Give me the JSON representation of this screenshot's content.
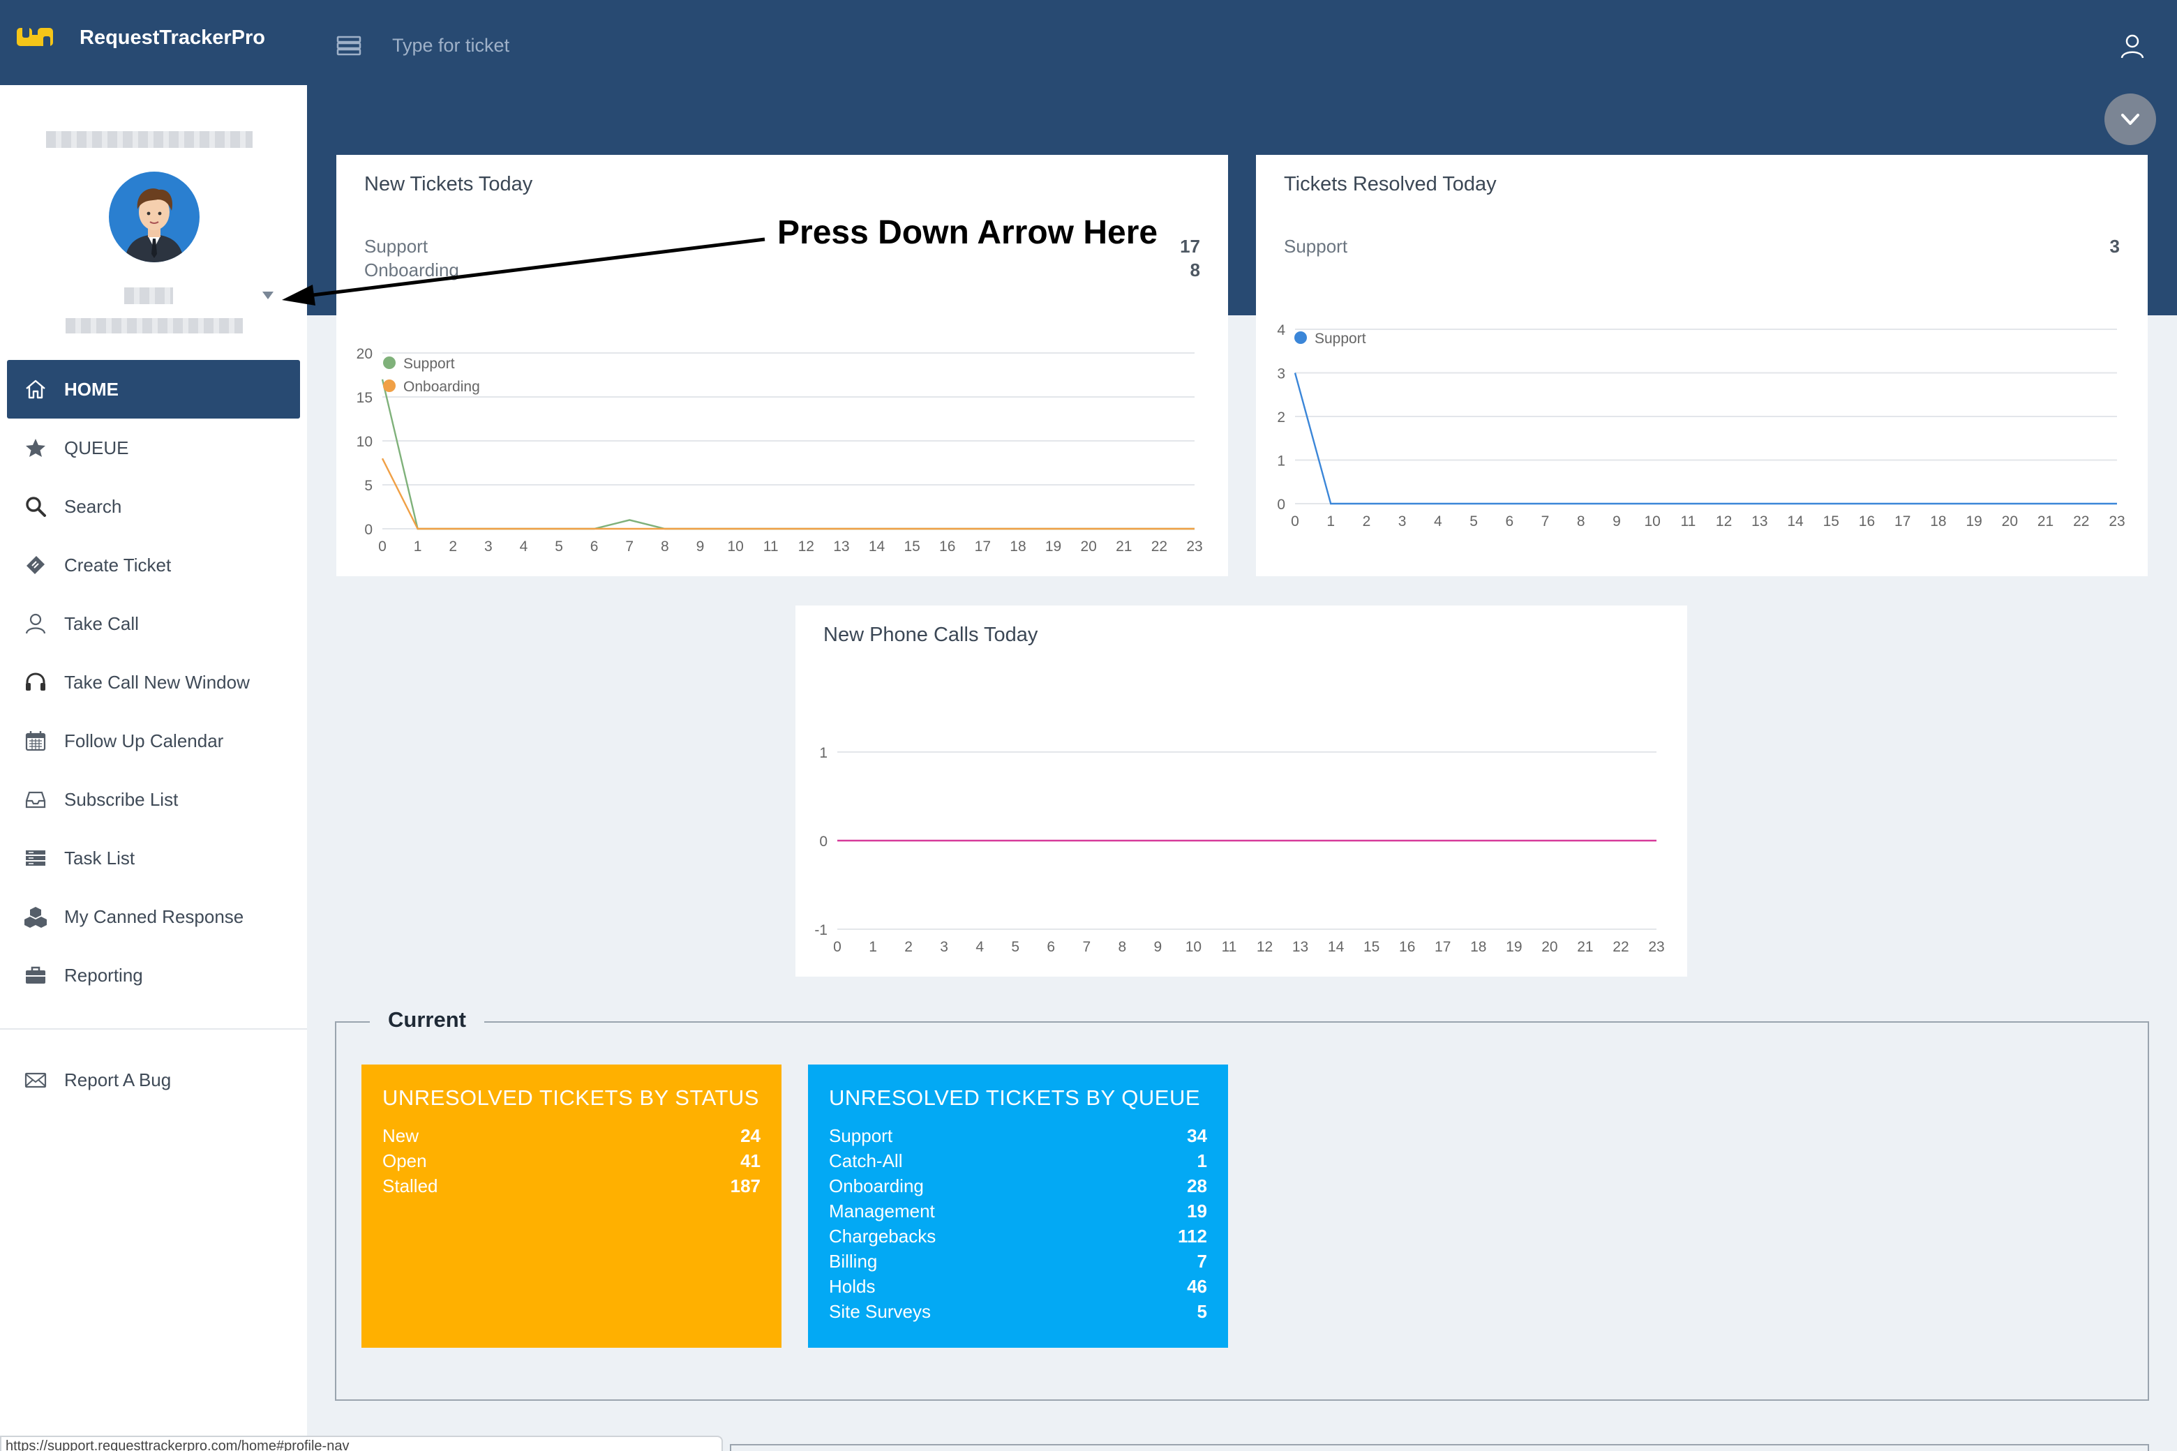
{
  "app": {
    "name": "RequestTrackerPro"
  },
  "header": {
    "search_placeholder": "Type for ticket"
  },
  "sidebar": {
    "items": [
      {
        "label": "HOME",
        "icon": "home-icon"
      },
      {
        "label": "QUEUE",
        "icon": "star-icon"
      },
      {
        "label": "Search",
        "icon": "search-icon"
      },
      {
        "label": "Create Ticket",
        "icon": "ticket-icon"
      },
      {
        "label": "Take Call",
        "icon": "person-icon"
      },
      {
        "label": "Take Call New Window",
        "icon": "headset-icon"
      },
      {
        "label": "Follow Up Calendar",
        "icon": "calendar-icon"
      },
      {
        "label": "Subscribe List",
        "icon": "inbox-icon"
      },
      {
        "label": "Task List",
        "icon": "list-icon"
      },
      {
        "label": "My Canned Response",
        "icon": "cubes-icon"
      },
      {
        "label": "Reporting",
        "icon": "briefcase-icon"
      }
    ],
    "report_bug": "Report A Bug"
  },
  "annotation": {
    "text": "Press Down Arrow Here"
  },
  "panels": {
    "new_tickets": {
      "title": "New Tickets Today",
      "legend": [
        {
          "name": "Support",
          "value": "17"
        },
        {
          "name": "Onboarding",
          "value": "8"
        }
      ]
    },
    "resolved": {
      "title": "Tickets Resolved Today",
      "legend": [
        {
          "name": "Support",
          "value": "3"
        }
      ]
    },
    "phone_calls": {
      "title": "New Phone Calls Today"
    }
  },
  "chart_data": [
    {
      "type": "line",
      "title": "New Tickets Today",
      "x": [
        0,
        1,
        2,
        3,
        4,
        5,
        6,
        7,
        8,
        9,
        10,
        11,
        12,
        13,
        14,
        15,
        16,
        17,
        18,
        19,
        20,
        21,
        22,
        23
      ],
      "ylim": [
        0,
        20
      ],
      "yticks": [
        0,
        5,
        10,
        15,
        20
      ],
      "legend": "top-left",
      "grid": true,
      "series": [
        {
          "name": "Support",
          "color": "#7fb17a",
          "values": [
            17,
            0,
            0,
            0,
            0,
            0,
            0,
            1,
            0,
            0,
            0,
            0,
            0,
            0,
            0,
            0,
            0,
            0,
            0,
            0,
            0,
            0,
            0,
            0
          ]
        },
        {
          "name": "Onboarding",
          "color": "#f0a046",
          "values": [
            8,
            0,
            0,
            0,
            0,
            0,
            0,
            0,
            0,
            0,
            0,
            0,
            0,
            0,
            0,
            0,
            0,
            0,
            0,
            0,
            0,
            0,
            0,
            0
          ]
        }
      ]
    },
    {
      "type": "line",
      "title": "Tickets Resolved Today",
      "x": [
        0,
        1,
        2,
        3,
        4,
        5,
        6,
        7,
        8,
        9,
        10,
        11,
        12,
        13,
        14,
        15,
        16,
        17,
        18,
        19,
        20,
        21,
        22,
        23
      ],
      "ylim": [
        0,
        4
      ],
      "yticks": [
        0,
        1,
        2,
        3,
        4
      ],
      "legend": "top-left",
      "grid": true,
      "series": [
        {
          "name": "Support",
          "color": "#3b86d8",
          "values": [
            3,
            0,
            0,
            0,
            0,
            0,
            0,
            0,
            0,
            0,
            0,
            0,
            0,
            0,
            0,
            0,
            0,
            0,
            0,
            0,
            0,
            0,
            0,
            0
          ]
        }
      ]
    },
    {
      "type": "line",
      "title": "New Phone Calls Today",
      "x": [
        0,
        1,
        2,
        3,
        4,
        5,
        6,
        7,
        8,
        9,
        10,
        11,
        12,
        13,
        14,
        15,
        16,
        17,
        18,
        19,
        20,
        21,
        22,
        23
      ],
      "ylim": [
        -1,
        1
      ],
      "yticks": [
        -1,
        0,
        1
      ],
      "grid": true,
      "series": [
        {
          "color": "#d63a9a",
          "values": [
            0,
            0,
            0,
            0,
            0,
            0,
            0,
            0,
            0,
            0,
            0,
            0,
            0,
            0,
            0,
            0,
            0,
            0,
            0,
            0,
            0,
            0,
            0,
            0
          ]
        }
      ]
    }
  ],
  "current": {
    "title": "Current",
    "by_status": {
      "title": "UNRESOLVED TICKETS BY STATUS",
      "color": "#ffb000",
      "rows": [
        {
          "label": "New",
          "value": "24"
        },
        {
          "label": "Open",
          "value": "41"
        },
        {
          "label": "Stalled",
          "value": "187"
        }
      ]
    },
    "by_queue": {
      "title": "UNRESOLVED TICKETS BY QUEUE",
      "color": "#03a9f4",
      "rows": [
        {
          "label": "Support",
          "value": "34"
        },
        {
          "label": "Catch-All",
          "value": "1"
        },
        {
          "label": "Onboarding",
          "value": "28"
        },
        {
          "label": "Management",
          "value": "19"
        },
        {
          "label": "Chargebacks",
          "value": "112"
        },
        {
          "label": "Billing",
          "value": "7"
        },
        {
          "label": "Holds",
          "value": "46"
        },
        {
          "label": "Site Surveys",
          "value": "5"
        }
      ]
    }
  },
  "status_url": "https://support.requesttrackerpro.com/home#profile-nav"
}
